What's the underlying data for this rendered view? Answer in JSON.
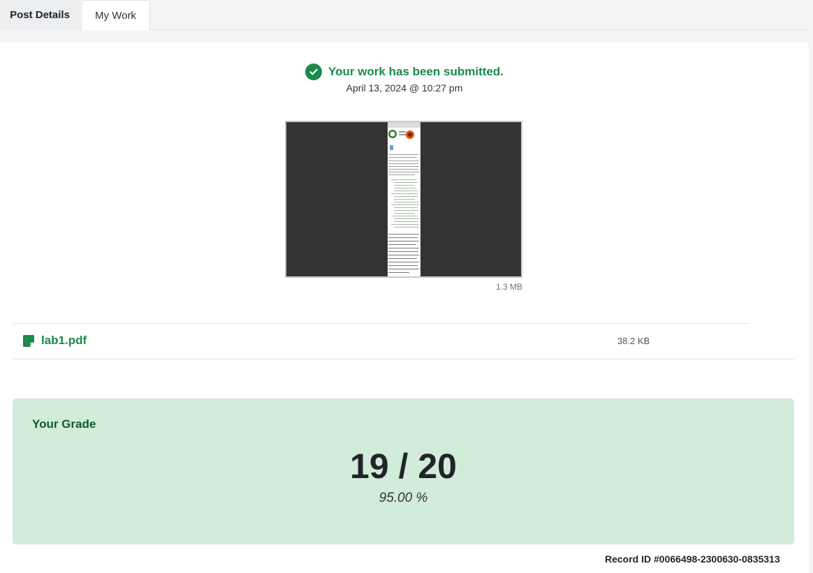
{
  "tabs": [
    {
      "label": "Post Details"
    },
    {
      "label": "My Work"
    }
  ],
  "submission": {
    "status": "Your work has been submitted.",
    "date": "April 13, 2024 @ 10:27 pm"
  },
  "preview": {
    "size": "1.3 MB"
  },
  "file": {
    "name": "lab1.pdf",
    "size": "38.2 KB"
  },
  "grade": {
    "label": "Your Grade",
    "score": "19 / 20",
    "percent": "95.00 %"
  },
  "record": {
    "id": "Record ID #0066498-2300630-0835313"
  },
  "colors": {
    "accent": "#1b8a4c",
    "grade_bg": "#d1ecd9"
  }
}
